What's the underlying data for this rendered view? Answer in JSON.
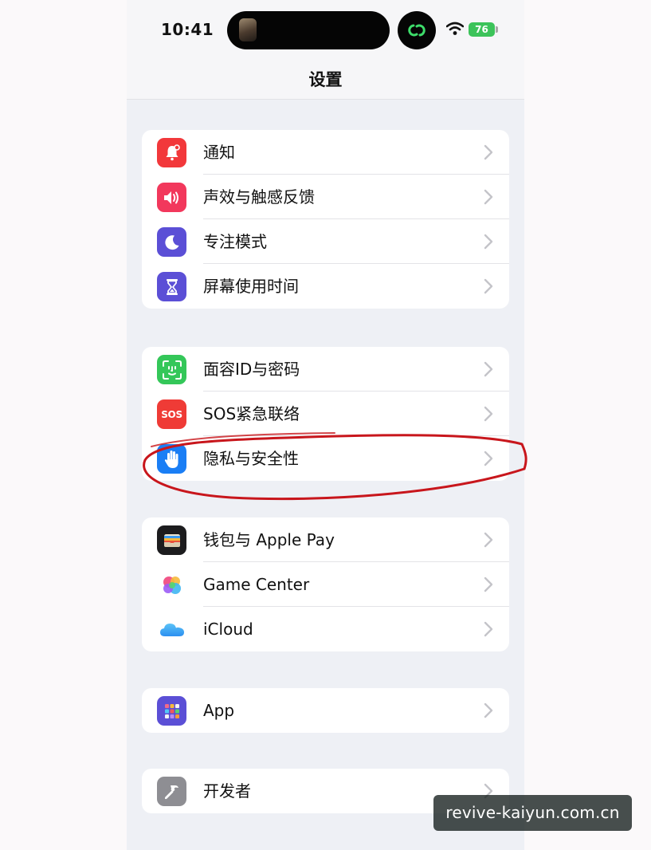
{
  "status_bar": {
    "time": "10:41",
    "battery": "76"
  },
  "nav": {
    "title": "设置"
  },
  "groups": [
    {
      "items": [
        {
          "label": "通知",
          "icon": "notification-bell-icon",
          "color": "#f2383b"
        },
        {
          "label": "声效与触感反馈",
          "icon": "speaker-icon",
          "color": "#f2385c"
        },
        {
          "label": "专注模式",
          "icon": "moon-icon",
          "color": "#5b4fd6"
        },
        {
          "label": "屏幕使用时间",
          "icon": "hourglass-icon",
          "color": "#5b4fd6"
        }
      ]
    },
    {
      "items": [
        {
          "label": "面容ID与密码",
          "icon": "face-id-icon",
          "color": "#34c759"
        },
        {
          "label": "SOS紧急联络",
          "icon": "sos-icon",
          "icon_text": "SOS",
          "color": "#ef3b36"
        },
        {
          "label": "隐私与安全性",
          "icon": "hand-icon",
          "color": "#1a7ef5"
        }
      ]
    },
    {
      "items": [
        {
          "label": "钱包与 Apple Pay",
          "icon": "wallet-icon",
          "color": "#1c1c1e"
        },
        {
          "label": "Game Center",
          "icon": "game-center-icon",
          "color": "#ffffff"
        },
        {
          "label": "iCloud",
          "icon": "icloud-icon",
          "color": "#ffffff"
        }
      ]
    },
    {
      "items": [
        {
          "label": "App",
          "icon": "app-grid-icon",
          "color": "#5b4fd6"
        }
      ]
    },
    {
      "items": [
        {
          "label": "开发者",
          "icon": "hammer-icon",
          "color": "#8e8e93"
        }
      ]
    }
  ],
  "annotation": {
    "color": "#c8161c"
  },
  "watermark": {
    "text": "revive-kaiyun.com.cn"
  }
}
